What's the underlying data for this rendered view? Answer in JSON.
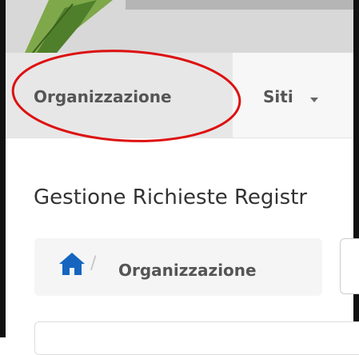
{
  "navbar": {
    "items": [
      {
        "label": "Organizzazione",
        "active": true
      },
      {
        "label": "Siti",
        "dropdown": true
      }
    ]
  },
  "page": {
    "title": "Gestione Richieste Registr"
  },
  "breadcrumb": {
    "home_icon": "home-icon",
    "separator": "/",
    "current": "Organizzazione"
  },
  "colors": {
    "home_icon": "#1565c0",
    "annotation_circle": "#dd1111"
  }
}
